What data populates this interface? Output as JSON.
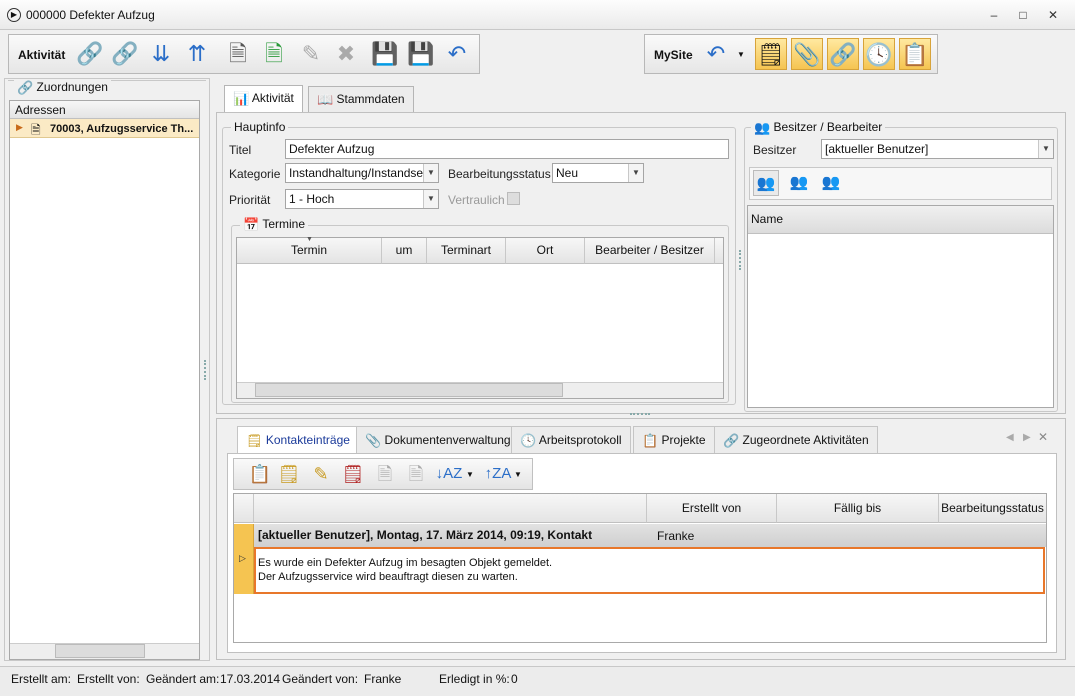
{
  "window": {
    "title": "000000 Defekter Aufzug",
    "min": "–",
    "max": "□",
    "close": "✕"
  },
  "toolbar": {
    "label": "Aktivität",
    "mysite_label": "MySite",
    "buttons": [
      "link-add",
      "link-remove",
      "arrow-down",
      "arrow-up",
      "new-document",
      "document-check",
      "edit",
      "delete",
      "save",
      "save-close",
      "undo-close"
    ],
    "right_buttons": [
      "undo",
      "note",
      "paperclip",
      "link",
      "clock",
      "clipboard"
    ]
  },
  "sidebar": {
    "group_label": "Zuordnungen",
    "column_header": "Adressen",
    "rows": [
      {
        "label": "70003, Aufzugsservice Th..."
      }
    ]
  },
  "tabs": {
    "active": "Aktivität",
    "second": "Stammdaten"
  },
  "hauptinfo": {
    "legend": "Hauptinfo",
    "titel_label": "Titel",
    "titel_value": "Defekter Aufzug",
    "kategorie_label": "Kategorie",
    "kategorie_value": "Instandhaltung/Instandse",
    "status_label": "Bearbeitungsstatus",
    "status_value": "Neu",
    "prioritaet_label": "Priorität",
    "prioritaet_value": "1 - Hoch",
    "vertraulich_label": "Vertraulich"
  },
  "termine": {
    "legend": "Termine",
    "columns": [
      "Termin",
      "um",
      "Terminart",
      "Ort",
      "Bearbeiter / Besitzer"
    ]
  },
  "besitzer": {
    "legend": "Besitzer / Bearbeiter",
    "label": "Besitzer",
    "value": "[aktueller Benutzer]",
    "column": "Name"
  },
  "bottom_tabs": [
    {
      "label": "Kontakteinträge",
      "icon": "note-icon"
    },
    {
      "label": "Dokumentenverwaltung",
      "icon": "attachment-icon"
    },
    {
      "label": "Arbeitsprotokoll",
      "icon": "clock-icon"
    },
    {
      "label": "Projekte",
      "icon": "folder-icon"
    },
    {
      "label": "Zugeordnete Aktivitäten",
      "icon": "link-icon"
    }
  ],
  "kontakt": {
    "columns": [
      "",
      "Erstellt von",
      "Fällig bis",
      "Bearbeitungsstatus"
    ],
    "entry": {
      "heading": "[aktueller Benutzer], Montag, 17. März 2014, 09:19, Kontakt",
      "erstellt_von": "Franke",
      "faellig": "",
      "status": "",
      "line1": "Es wurde ein Defekter Aufzug im besagten Objekt gemeldet.",
      "line2": "Der Aufzugsservice wird beauftragt diesen zu warten."
    }
  },
  "statusbar": {
    "erstellt_am_label": "Erstellt am:",
    "erstellt_von_label": "Erstellt von:",
    "geaendert_am_label": "Geändert am:",
    "geaendert_am_value": "17.03.2014",
    "geaendert_von_label": "Geändert von:",
    "geaendert_von_value": "Franke",
    "erledigt_label": "Erledigt in %:",
    "erledigt_value": "0"
  },
  "colors": {
    "accent": "#f5c451",
    "selection": "#e8772a",
    "tab_active_text": "#1a3a9a"
  }
}
